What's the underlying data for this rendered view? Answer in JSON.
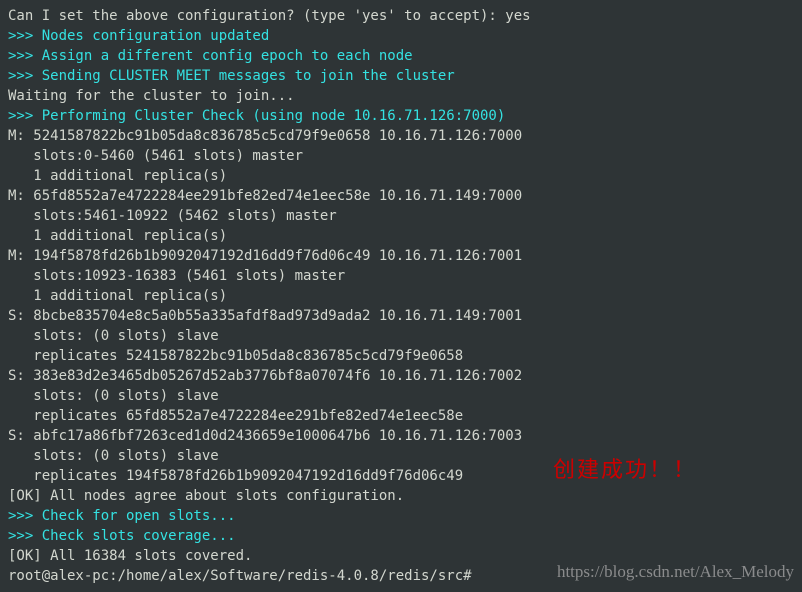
{
  "lines": [
    {
      "cls": "white",
      "text": "Can I set the above configuration? (type 'yes' to accept): yes"
    },
    {
      "cls": "cyan",
      "text": ">>> Nodes configuration updated"
    },
    {
      "cls": "cyan",
      "text": ">>> Assign a different config epoch to each node"
    },
    {
      "cls": "cyan",
      "text": ">>> Sending CLUSTER MEET messages to join the cluster"
    },
    {
      "cls": "white",
      "text": "Waiting for the cluster to join..."
    },
    {
      "cls": "cyan",
      "text": ">>> Performing Cluster Check (using node 10.16.71.126:7000)"
    },
    {
      "cls": "white",
      "text": "M: 5241587822bc91b05da8c836785c5cd79f9e0658 10.16.71.126:7000"
    },
    {
      "cls": "white",
      "text": "   slots:0-5460 (5461 slots) master"
    },
    {
      "cls": "white",
      "text": "   1 additional replica(s)"
    },
    {
      "cls": "white",
      "text": "M: 65fd8552a7e4722284ee291bfe82ed74e1eec58e 10.16.71.149:7000"
    },
    {
      "cls": "white",
      "text": "   slots:5461-10922 (5462 slots) master"
    },
    {
      "cls": "white",
      "text": "   1 additional replica(s)"
    },
    {
      "cls": "white",
      "text": "M: 194f5878fd26b1b9092047192d16dd9f76d06c49 10.16.71.126:7001"
    },
    {
      "cls": "white",
      "text": "   slots:10923-16383 (5461 slots) master"
    },
    {
      "cls": "white",
      "text": "   1 additional replica(s)"
    },
    {
      "cls": "white",
      "text": "S: 8bcbe835704e8c5a0b55a335afdf8ad973d9ada2 10.16.71.149:7001"
    },
    {
      "cls": "white",
      "text": "   slots: (0 slots) slave"
    },
    {
      "cls": "white",
      "text": "   replicates 5241587822bc91b05da8c836785c5cd79f9e0658"
    },
    {
      "cls": "white",
      "text": "S: 383e83d2e3465db05267d52ab3776bf8a07074f6 10.16.71.126:7002"
    },
    {
      "cls": "white",
      "text": "   slots: (0 slots) slave"
    },
    {
      "cls": "white",
      "text": "   replicates 65fd8552a7e4722284ee291bfe82ed74e1eec58e"
    },
    {
      "cls": "white",
      "text": "S: abfc17a86fbf7263ced1d0d2436659e1000647b6 10.16.71.126:7003"
    },
    {
      "cls": "white",
      "text": "   slots: (0 slots) slave"
    },
    {
      "cls": "white",
      "text": "   replicates 194f5878fd26b1b9092047192d16dd9f76d06c49"
    },
    {
      "cls": "white",
      "text": "[OK] All nodes agree about slots configuration."
    },
    {
      "cls": "cyan",
      "text": ">>> Check for open slots..."
    },
    {
      "cls": "cyan",
      "text": ">>> Check slots coverage..."
    },
    {
      "cls": "white",
      "text": "[OK] All 16384 slots covered."
    },
    {
      "cls": "white",
      "text": "root@alex-pc:/home/alex/Software/redis-4.0.8/redis/src# "
    }
  ],
  "overlay": {
    "success": "创建成功！！",
    "url": "https://blog.csdn.net/Alex_Melody"
  }
}
